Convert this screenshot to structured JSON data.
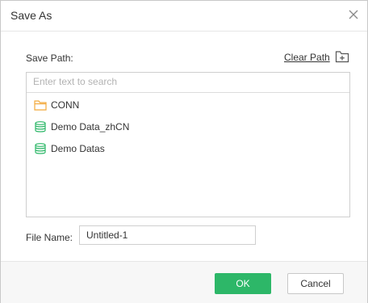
{
  "dialog": {
    "title": "Save As",
    "close_icon": "close-icon"
  },
  "path": {
    "label": "Save Path:",
    "clear_label": "Clear Path",
    "new_folder_icon": "new-folder-icon"
  },
  "search": {
    "placeholder": "Enter text to search",
    "value": ""
  },
  "tree": {
    "items": [
      {
        "label": "CONN",
        "icon": "folder-icon"
      },
      {
        "label": "Demo Data_zhCN",
        "icon": "database-icon"
      },
      {
        "label": "Demo Datas",
        "icon": "database-icon"
      }
    ]
  },
  "file": {
    "label": "File Name:",
    "value": "Untitled-1"
  },
  "footer": {
    "ok_label": "OK",
    "cancel_label": "Cancel"
  },
  "colors": {
    "accent": "#2db768",
    "folder": "#f2a93b",
    "database": "#2db768"
  }
}
